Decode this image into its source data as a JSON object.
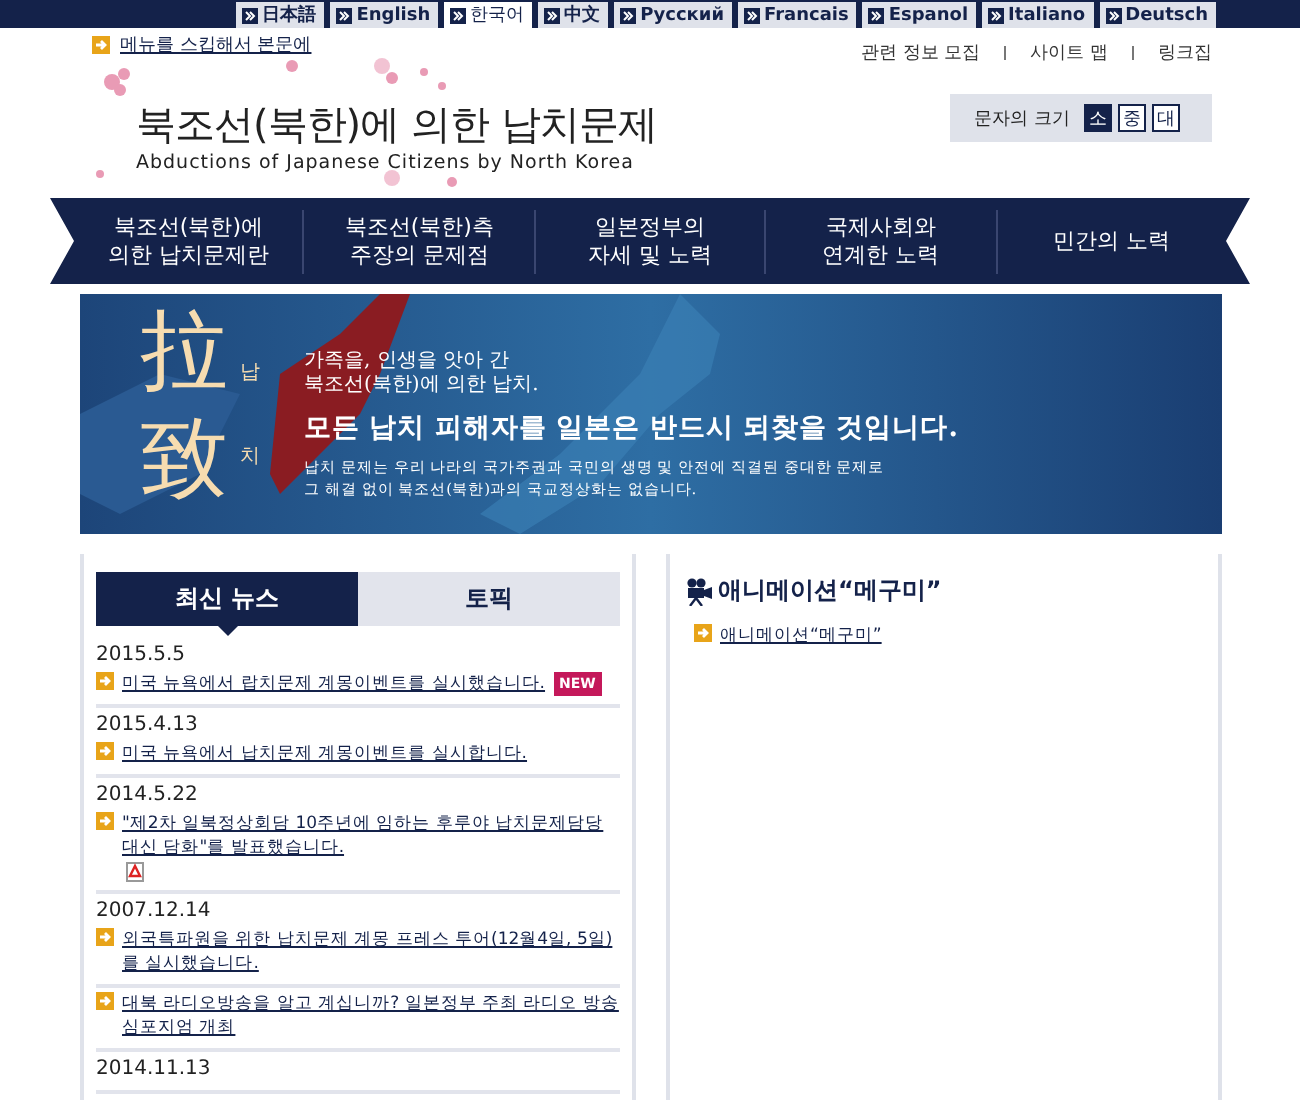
{
  "languages": [
    {
      "label": "日本語",
      "selected": false
    },
    {
      "label": "English",
      "selected": false
    },
    {
      "label": "한국어",
      "selected": true
    },
    {
      "label": "中文",
      "selected": false
    },
    {
      "label": "Русский",
      "selected": false
    },
    {
      "label": "Francais",
      "selected": false
    },
    {
      "label": "Espanol",
      "selected": false
    },
    {
      "label": "Italiano",
      "selected": false
    },
    {
      "label": "Deutsch",
      "selected": false
    }
  ],
  "skip_link": "메뉴를 스킵해서 본문에",
  "utility_links": [
    "관련 정보 모집",
    "사이트 맵",
    "링크집"
  ],
  "logo": {
    "title": "북조선(북한)에 의한 납치문제",
    "subtitle": "Abductions of Japanese Citizens by North Korea"
  },
  "font_size": {
    "label": "문자의 크기",
    "options": [
      {
        "label": "소",
        "selected": true
      },
      {
        "label": "중",
        "selected": false
      },
      {
        "label": "대",
        "selected": false
      }
    ]
  },
  "nav": [
    {
      "lines": [
        "북조선(북한)에",
        "의한 납치문제란"
      ]
    },
    {
      "lines": [
        "북조선(북한)측",
        "주장의 문제점"
      ]
    },
    {
      "lines": [
        "일본정부의",
        "자세 및 노력"
      ]
    },
    {
      "lines": [
        "국제사회와",
        "연계한 노력"
      ]
    },
    {
      "lines": [
        "민간의 노력"
      ]
    }
  ],
  "banner": {
    "big_chars": [
      "拉",
      "致"
    ],
    "small_chars": [
      "납",
      "치"
    ],
    "intro": [
      "가족을, 인생을 앗아 간",
      "북조선(북한)에 의한 납치."
    ],
    "headline": "모든 납치 피해자를 일본은 반드시 되찾을 것입니다.",
    "body": [
      "납치 문제는 우리 나라의 국가주권과 국민의 생명 및 안전에 직결된 중대한 문제로",
      "그 해결 없이 북조선(북한)과의 국교정상화는 없습니다."
    ]
  },
  "news_tabs": [
    {
      "label": "최신 뉴스",
      "selected": true
    },
    {
      "label": "토픽",
      "selected": false
    }
  ],
  "news": [
    {
      "date": "2015.5.5",
      "links": [
        {
          "text": "미국 뉴욕에서 랍치문제 계몽이벤트를 실시했습니다.",
          "badge": "NEW"
        }
      ]
    },
    {
      "date": "2015.4.13",
      "links": [
        {
          "text": "미국 뉴욕에서 납치문제 계몽이벤트를 실시합니다."
        }
      ]
    },
    {
      "date": "2014.5.22",
      "links": [
        {
          "text": "\"제2차 일북정상회담 10주년에 임하는 후루야 납치문제담당대신 담화\"를 발표했습니다.",
          "pdf": true
        }
      ]
    },
    {
      "date": "2007.12.14",
      "links": [
        {
          "text": "외국특파원을 위한 납치문제 계몽 프레스 투어(12월4일, 5일)를 실시했습니다."
        }
      ]
    },
    {
      "links": [
        {
          "text": "대북 라디오방송을 알고 계십니까? 일본정부 주최 라디오 방송 심포지엄 개최"
        }
      ]
    },
    {
      "date": "2014.11.13"
    }
  ],
  "anime": {
    "title": "애니메이션“메구미”",
    "links": [
      "애니메이션“메구미”"
    ]
  }
}
